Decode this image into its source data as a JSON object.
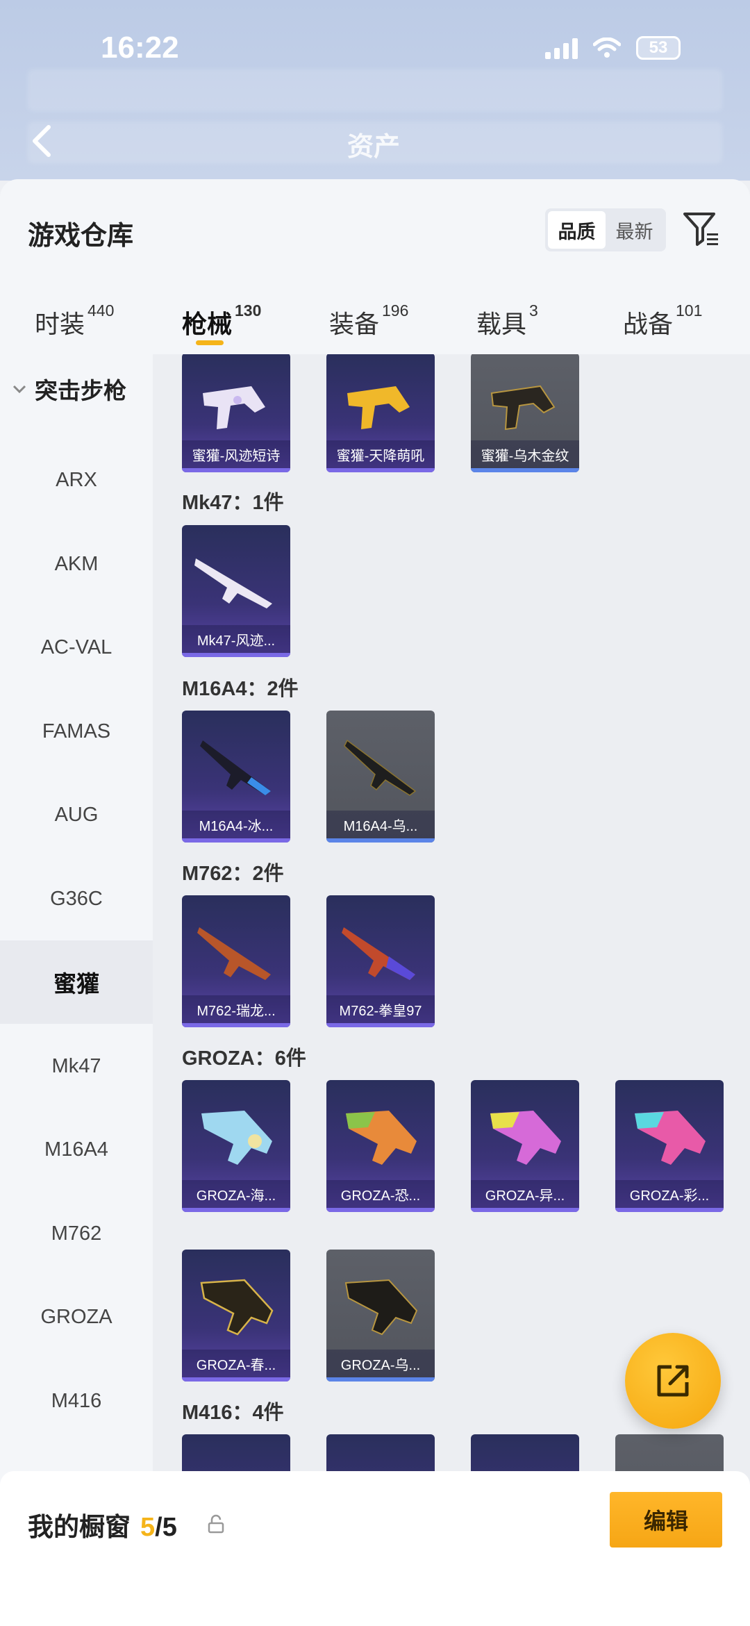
{
  "status": {
    "time": "16:22",
    "battery": "53"
  },
  "header": {
    "title": "资产"
  },
  "sheet": {
    "title": "游戏仓库",
    "sort": [
      "品质",
      "最新"
    ]
  },
  "tabs": [
    {
      "label": "时装",
      "count": "440"
    },
    {
      "label": "枪械",
      "count": "130"
    },
    {
      "label": "装备",
      "count": "196"
    },
    {
      "label": "载具",
      "count": "3"
    },
    {
      "label": "战备",
      "count": "101"
    }
  ],
  "sidebar": {
    "group": "突击步枪",
    "items": [
      "ARX",
      "AKM",
      "AC-VAL",
      "FAMAS",
      "AUG",
      "G36C",
      "蜜獾",
      "Mk47",
      "M16A4",
      "M762",
      "GROZA",
      "M416"
    ]
  },
  "content": {
    "top_cards": [
      "蜜獾-风迹短诗",
      "蜜獾-天降萌吼",
      "蜜獾-乌木金纹"
    ],
    "groups": [
      {
        "label": "Mk47：1件",
        "cards": [
          "Mk47-风迹..."
        ]
      },
      {
        "label": "M16A4：2件",
        "cards": [
          "M16A4-冰...",
          "M16A4-乌..."
        ]
      },
      {
        "label": "M762：2件",
        "cards": [
          "M762-瑞龙...",
          "M762-拳皇97"
        ]
      },
      {
        "label": "GROZA：6件",
        "cards": [
          "GROZA-海...",
          "GROZA-恐...",
          "GROZA-异...",
          "GROZA-彩...",
          "GROZA-春...",
          "GROZA-乌..."
        ]
      },
      {
        "label": "M416：4件",
        "cards": []
      }
    ]
  },
  "bottom": {
    "label": "我的橱窗",
    "current": "5",
    "total": "/5",
    "edit": "编辑"
  },
  "colors": {
    "accent": "#f5b41a",
    "card_purple": "#3a3377",
    "card_grey": "#55585f"
  }
}
